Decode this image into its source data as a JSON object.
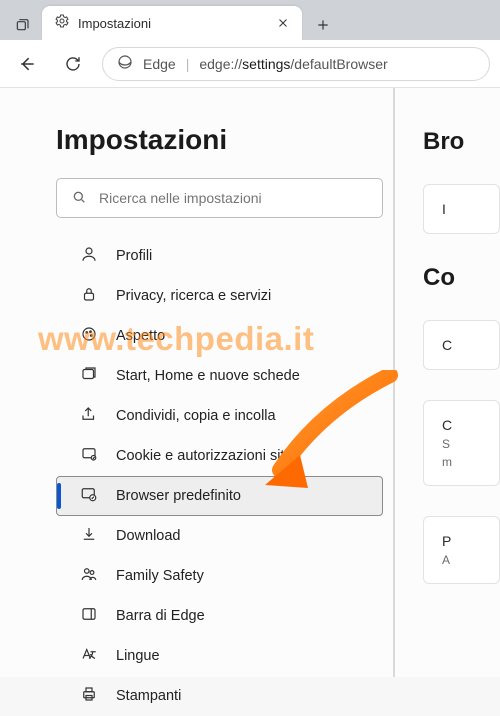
{
  "tab": {
    "title": "Impostazioni"
  },
  "addr": {
    "brand": "Edge",
    "prefix": "edge://",
    "strong": "settings",
    "suffix": "/defaultBrowser"
  },
  "page": {
    "heading": "Impostazioni"
  },
  "search": {
    "placeholder": "Ricerca nelle impostazioni"
  },
  "sidebar": {
    "items": [
      {
        "label": "Profili"
      },
      {
        "label": "Privacy, ricerca e servizi"
      },
      {
        "label": "Aspetto"
      },
      {
        "label": "Start, Home e nuove schede"
      },
      {
        "label": "Condividi, copia e incolla"
      },
      {
        "label": "Cookie e autorizzazioni sito"
      },
      {
        "label": "Browser predefinito"
      },
      {
        "label": "Download"
      },
      {
        "label": "Family Safety"
      },
      {
        "label": "Barra di Edge"
      },
      {
        "label": "Lingue"
      },
      {
        "label": "Stampanti"
      }
    ]
  },
  "right": {
    "h1": "Bro",
    "c1": "I",
    "h2": "Co",
    "c2": "C",
    "c3a": "C",
    "c3b": "S",
    "c3c": "m",
    "c4a": "P",
    "c4b": "A"
  },
  "watermark": "www.techpedia.it"
}
